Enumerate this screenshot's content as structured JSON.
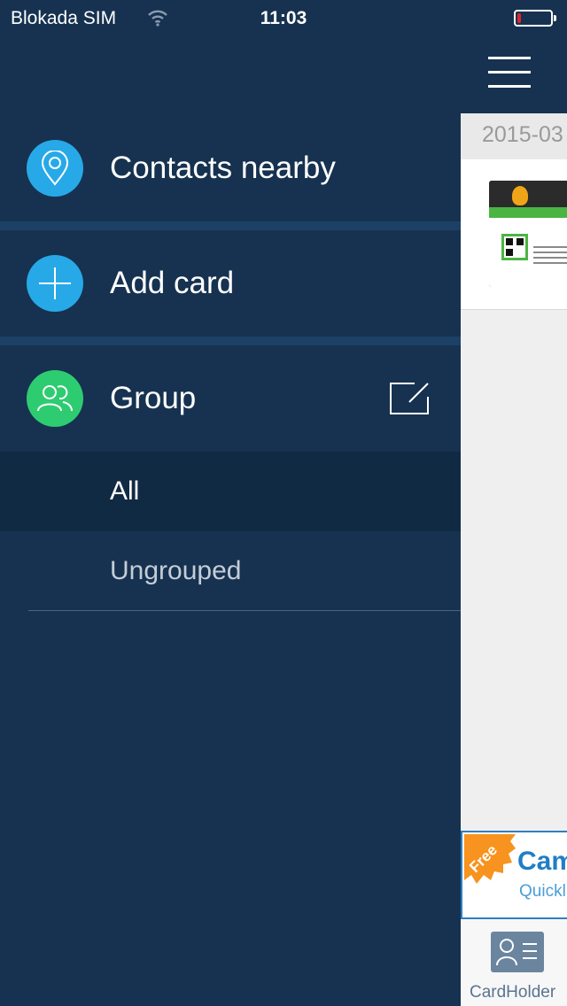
{
  "status_bar": {
    "carrier": "Blokada SIM",
    "time": "11:03",
    "battery_color": "#e0262a",
    "battery_level": 0.1
  },
  "drawer": {
    "items": [
      {
        "label": "Contacts nearby",
        "icon": "location-pin-icon",
        "icon_color": "#27a9e8"
      },
      {
        "label": "Add card",
        "icon": "plus-icon",
        "icon_color": "#27a9e8"
      },
      {
        "label": "Group",
        "icon": "people-icon",
        "icon_color": "#2ecc71"
      }
    ],
    "group_edit_icon": "edit-icon",
    "groups": [
      {
        "label": "All",
        "selected": true
      },
      {
        "label": "Ungrouped",
        "selected": false
      }
    ]
  },
  "main": {
    "menu_icon": "hamburger-menu-icon",
    "date_header": "2015-03",
    "ad": {
      "badge": "Free",
      "title": "Cam",
      "subtitle": "Quickl"
    },
    "tab": {
      "label": "CardHolder",
      "icon": "card-holder-icon"
    }
  },
  "colors": {
    "drawer_bg": "#163250",
    "selected_group_bg": "#112a44",
    "accent_blue": "#27a9e8",
    "accent_green": "#2ecc71",
    "ad_badge": "#f7931e"
  }
}
